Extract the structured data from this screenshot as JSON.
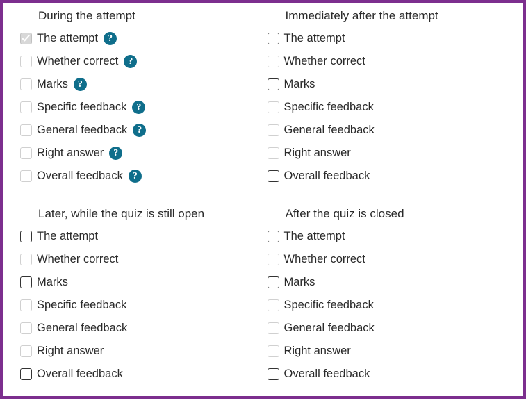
{
  "sections": [
    {
      "title": "During the attempt",
      "options": [
        {
          "label": "The attempt",
          "state": "checked-disabled",
          "help": true
        },
        {
          "label": "Whether correct",
          "state": "disabled-empty",
          "help": true
        },
        {
          "label": "Marks",
          "state": "disabled-empty",
          "help": true
        },
        {
          "label": "Specific feedback",
          "state": "disabled-empty",
          "help": true
        },
        {
          "label": "General feedback",
          "state": "disabled-empty",
          "help": true
        },
        {
          "label": "Right answer",
          "state": "disabled-empty",
          "help": true
        },
        {
          "label": "Overall feedback",
          "state": "disabled-empty",
          "help": true
        }
      ]
    },
    {
      "title": "Immediately after the attempt",
      "options": [
        {
          "label": "The attempt",
          "state": "unchecked-dark",
          "help": false
        },
        {
          "label": "Whether correct",
          "state": "disabled-empty",
          "help": false
        },
        {
          "label": "Marks",
          "state": "unchecked-dark",
          "help": false
        },
        {
          "label": "Specific feedback",
          "state": "disabled-empty",
          "help": false
        },
        {
          "label": "General feedback",
          "state": "disabled-empty",
          "help": false
        },
        {
          "label": "Right answer",
          "state": "disabled-empty",
          "help": false
        },
        {
          "label": "Overall feedback",
          "state": "unchecked-dark",
          "help": false
        }
      ]
    },
    {
      "title": "Later, while the quiz is still open",
      "options": [
        {
          "label": "The attempt",
          "state": "unchecked-dark",
          "help": false
        },
        {
          "label": "Whether correct",
          "state": "disabled-empty",
          "help": false
        },
        {
          "label": "Marks",
          "state": "unchecked-dark",
          "help": false
        },
        {
          "label": "Specific feedback",
          "state": "disabled-empty",
          "help": false
        },
        {
          "label": "General feedback",
          "state": "disabled-empty",
          "help": false
        },
        {
          "label": "Right answer",
          "state": "disabled-empty",
          "help": false
        },
        {
          "label": "Overall feedback",
          "state": "unchecked-dark",
          "help": false
        }
      ]
    },
    {
      "title": "After the quiz is closed",
      "options": [
        {
          "label": "The attempt",
          "state": "unchecked-dark",
          "help": false
        },
        {
          "label": "Whether correct",
          "state": "disabled-empty",
          "help": false
        },
        {
          "label": "Marks",
          "state": "unchecked-dark",
          "help": false
        },
        {
          "label": "Specific feedback",
          "state": "disabled-empty",
          "help": false
        },
        {
          "label": "General feedback",
          "state": "disabled-empty",
          "help": false
        },
        {
          "label": "Right answer",
          "state": "disabled-empty",
          "help": false
        },
        {
          "label": "Overall feedback",
          "state": "unchecked-dark",
          "help": false
        }
      ]
    }
  ]
}
